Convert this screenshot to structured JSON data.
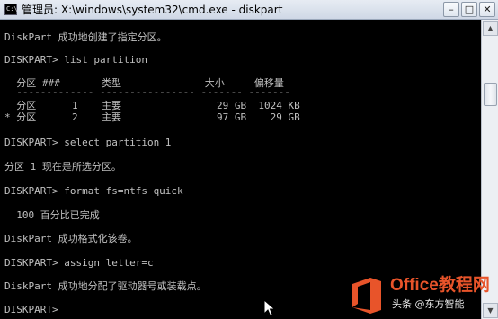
{
  "window": {
    "title": "管理员: X:\\windows\\system32\\cmd.exe - diskpart",
    "minimize_glyph": "–",
    "maximize_glyph": "□",
    "close_glyph": "✕"
  },
  "console": {
    "lines": [
      "DiskPart 成功地创建了指定分区。",
      "DISKPART> list partition",
      "  分区 ###       类型              大小     偏移量",
      "  ------------- ---------------- ------- -------",
      "  分区      1    主要                29 GB  1024 KB",
      "* 分区      2    主要                97 GB    29 GB",
      "DISKPART> select partition 1",
      "分区 1 现在是所选分区。",
      "DISKPART> format fs=ntfs quick",
      "  100 百分比已完成",
      "DiskPart 成功格式化该卷。",
      "DISKPART> assign letter=c",
      "DiskPart 成功地分配了驱动器号或装载点。",
      "DISKPART>"
    ]
  },
  "scrollbar": {
    "up_glyph": "▲",
    "down_glyph": "▼"
  },
  "watermark": {
    "brand": "Office教程网",
    "subtitle": "头条 @东方智能"
  },
  "colors": {
    "console_bg": "#000000",
    "console_text": "#c0c0c0",
    "watermark_brand": "#e8542a"
  }
}
